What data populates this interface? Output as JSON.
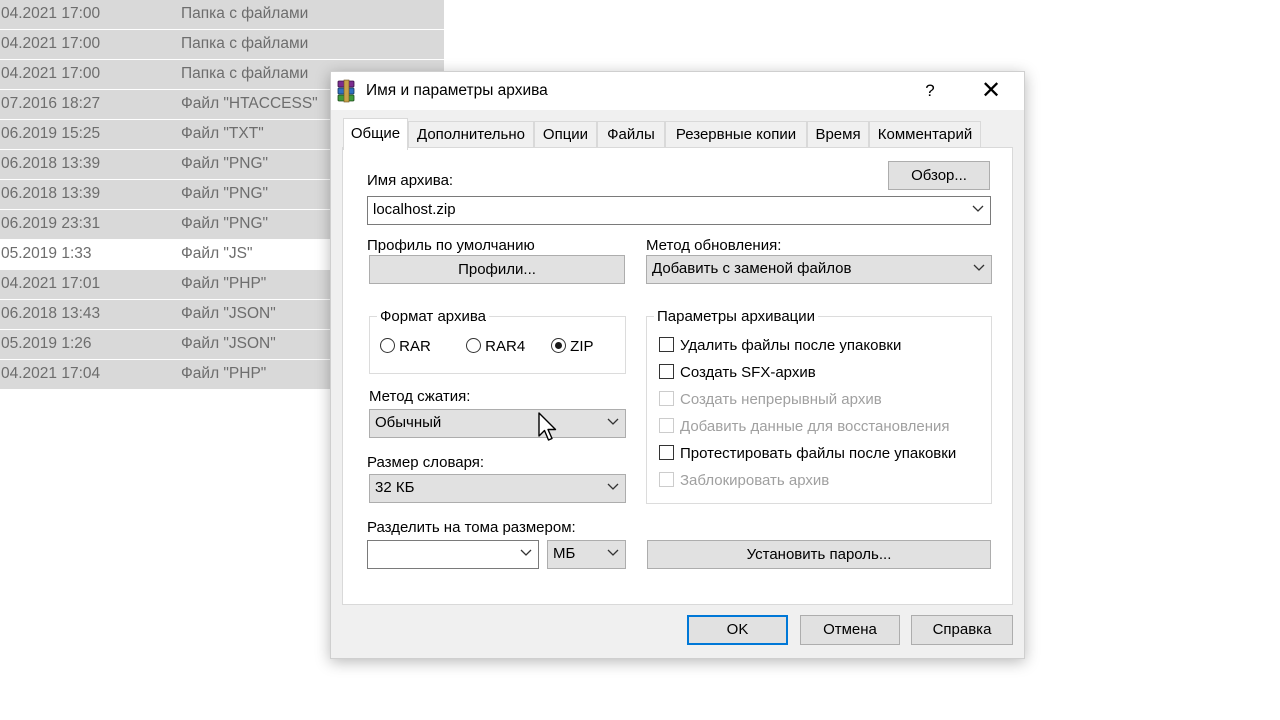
{
  "file_list": [
    {
      "date": "04.2021 17:00",
      "type": "Папка с файлами",
      "selected": false
    },
    {
      "date": "04.2021 17:00",
      "type": "Папка с файлами",
      "selected": false
    },
    {
      "date": "04.2021 17:00",
      "type": "Папка с файлами",
      "selected": false
    },
    {
      "date": "07.2016 18:27",
      "type": "Файл \"HTACCESS\"",
      "selected": false
    },
    {
      "date": "06.2019 15:25",
      "type": "Файл \"TXT\"",
      "selected": false
    },
    {
      "date": "06.2018 13:39",
      "type": "Файл \"PNG\"",
      "selected": false
    },
    {
      "date": "06.2018 13:39",
      "type": "Файл \"PNG\"",
      "selected": false
    },
    {
      "date": "06.2019 23:31",
      "type": "Файл \"PNG\"",
      "selected": false
    },
    {
      "date": "05.2019 1:33",
      "type": "Файл \"JS\"",
      "selected": true
    },
    {
      "date": "04.2021 17:01",
      "type": "Файл \"PHP\"",
      "selected": false
    },
    {
      "date": "06.2018 13:43",
      "type": "Файл \"JSON\"",
      "selected": false
    },
    {
      "date": "05.2019 1:26",
      "type": "Файл \"JSON\"",
      "selected": false
    },
    {
      "date": "04.2021 17:04",
      "type": "Файл \"PHP\"",
      "selected": false
    }
  ],
  "dialog": {
    "title": "Имя и параметры архива",
    "help_label": "?",
    "close_label": "✕",
    "app_icon": "winrar-books-icon",
    "tabs": [
      {
        "label": "Общие",
        "active": true
      },
      {
        "label": "Дополнительно",
        "active": false
      },
      {
        "label": "Опции",
        "active": false
      },
      {
        "label": "Файлы",
        "active": false
      },
      {
        "label": "Резервные копии",
        "active": false
      },
      {
        "label": "Время",
        "active": false
      },
      {
        "label": "Комментарий",
        "active": false
      }
    ],
    "general": {
      "archive_name_label": "Имя архива:",
      "browse_button": "Обзор...",
      "archive_name_value": "localhost.zip",
      "default_profile_label": "Профиль по умолчанию",
      "profiles_button": "Профили...",
      "update_method_label": "Метод обновления:",
      "update_method_value": "Добавить с заменой файлов",
      "archive_format_label": "Формат архива",
      "formats": [
        {
          "label": "RAR",
          "selected": false
        },
        {
          "label": "RAR4",
          "selected": false
        },
        {
          "label": "ZIP",
          "selected": true
        }
      ],
      "compression_method_label": "Метод сжатия:",
      "compression_method_value": "Обычный",
      "dictionary_size_label": "Размер словаря:",
      "dictionary_size_value": "32 КБ",
      "split_volumes_label": "Разделить на тома размером:",
      "split_volumes_value": "",
      "split_unit_value": "МБ",
      "archive_options_label": "Параметры архивации",
      "options": [
        {
          "label": "Удалить файлы после упаковки",
          "checked": false,
          "enabled": true
        },
        {
          "label": "Создать SFX-архив",
          "checked": false,
          "enabled": true
        },
        {
          "label": "Создать непрерывный архив",
          "checked": false,
          "enabled": false
        },
        {
          "label": "Добавить данные для восстановления",
          "checked": false,
          "enabled": false
        },
        {
          "label": "Протестировать файлы после упаковки",
          "checked": false,
          "enabled": true
        },
        {
          "label": "Заблокировать архив",
          "checked": false,
          "enabled": false
        }
      ],
      "set_password_button": "Установить пароль..."
    },
    "footer": {
      "ok_button": "OK",
      "cancel_button": "Отмена",
      "help_button": "Справка"
    }
  },
  "colors": {
    "list_bg": "#d9d9d9",
    "list_text": "#6d6d6d",
    "button_face": "#e1e1e1",
    "focus_border": "#0078d7"
  }
}
